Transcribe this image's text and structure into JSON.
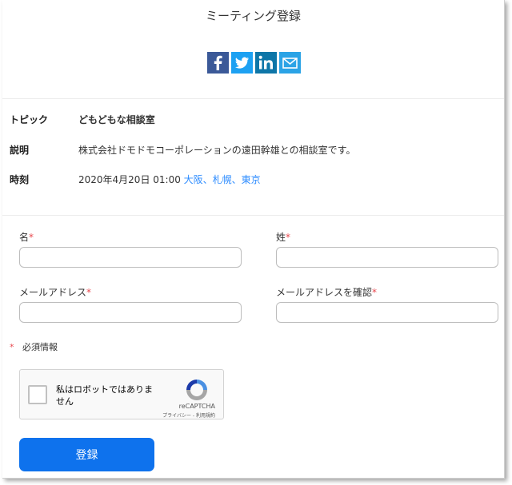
{
  "page": {
    "title": "ミーティング登録"
  },
  "share": {
    "icons": [
      "facebook-icon",
      "twitter-icon",
      "linkedin-icon",
      "mail-icon"
    ]
  },
  "meeting": {
    "topic_label": "トピック",
    "topic": "どもどもな相談室",
    "description_label": "説明",
    "description": "株式会社ドモドモコーポレーションの遠田幹雄との相談室です。",
    "time_label": "時刻",
    "time": "2020年4月20日 01:00",
    "timezones": "大阪、札幌、東京"
  },
  "form": {
    "first_name_label": "名",
    "last_name_label": "姓",
    "email_label": "メールアドレス",
    "email_confirm_label": "メールアドレスを確認",
    "required_mark": "*",
    "required_note": "必須情報",
    "first_name_value": "",
    "last_name_value": "",
    "email_value": "",
    "email_confirm_value": ""
  },
  "recaptcha": {
    "label": "私はロボットではありません",
    "brand": "reCAPTCHA",
    "links": "プライバシー - 利用規約"
  },
  "submit": {
    "label": "登録"
  },
  "colors": {
    "accent": "#0e72ed",
    "link": "#2d8cff",
    "required": "#e8474d"
  }
}
